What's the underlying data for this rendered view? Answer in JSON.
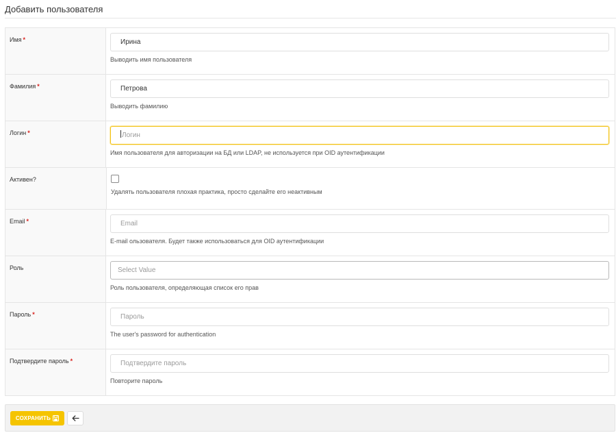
{
  "page": {
    "title": "Добавить пользователя"
  },
  "colors": {
    "accent": "#f5c400",
    "required": "#d9231e",
    "focus": "#f3c316"
  },
  "form": {
    "first_name": {
      "label": "Имя",
      "required_mark": "*",
      "value": "Ирина",
      "help": "Выводить имя пользователя"
    },
    "last_name": {
      "label": "Фамилия",
      "required_mark": "*",
      "value": "Петрова",
      "help": "Выводить фамилию"
    },
    "login": {
      "label": "Логин",
      "required_mark": "*",
      "value": "",
      "placeholder": "Логин",
      "help": "Имя пользователя для авторизации на БД или LDAP, не используется при OID аутентификации"
    },
    "active": {
      "label": "Активен?",
      "checked": false,
      "help": "Удалять пользователя плохая практика, просто сделайте его неактивным"
    },
    "email": {
      "label": "Email",
      "required_mark": "*",
      "value": "",
      "placeholder": "Email",
      "help": "E-mail ользователя. Будет также использоваться для OID аутентификации"
    },
    "role": {
      "label": "Роль",
      "value": "",
      "placeholder": "Select Value",
      "help": "Роль пользователя, определяющая список его прав"
    },
    "password": {
      "label": "Пароль",
      "required_mark": "*",
      "value": "",
      "placeholder": "Пароль",
      "help": "The user's password for authentication"
    },
    "password_confirm": {
      "label": "Подтвердите пароль",
      "required_mark": "*",
      "value": "",
      "placeholder": "Подтвердите пароль",
      "help": "Повторите пароль"
    }
  },
  "footer": {
    "save_label": "СОХРАНИТЬ",
    "save_icon": "save-icon",
    "back_icon": "arrow-left-icon"
  }
}
